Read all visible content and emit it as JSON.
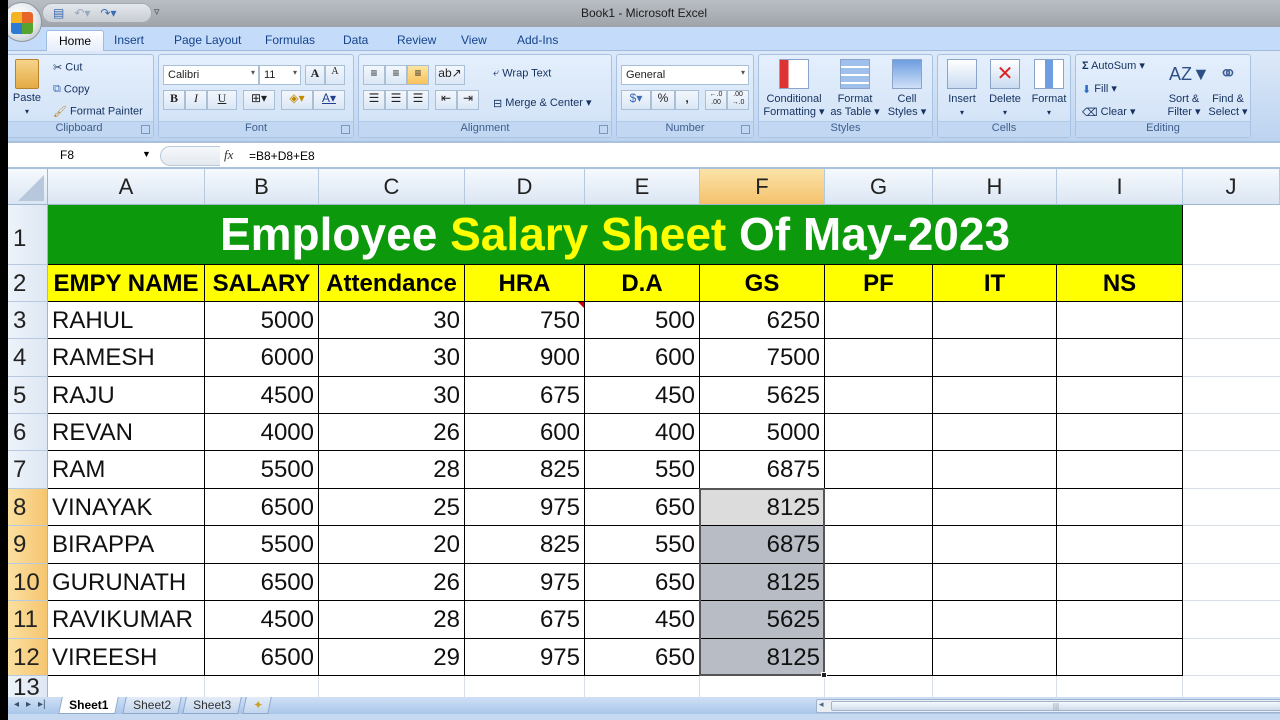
{
  "window": {
    "title": "Book1 - Microsoft Excel"
  },
  "qat": {
    "save_icon": "save-icon",
    "undo_icon": "undo-icon",
    "redo_icon": "redo-icon"
  },
  "tabs": [
    {
      "label": "Home",
      "active": true
    },
    {
      "label": "Insert"
    },
    {
      "label": "Page Layout"
    },
    {
      "label": "Formulas"
    },
    {
      "label": "Data"
    },
    {
      "label": "Review"
    },
    {
      "label": "View"
    },
    {
      "label": "Add-Ins"
    }
  ],
  "ribbon": {
    "clipboard": {
      "label": "Clipboard",
      "paste": "Paste",
      "cut": "Cut",
      "copy": "Copy",
      "format_painter": "Format Painter"
    },
    "font": {
      "label": "Font",
      "font_name": "Calibri",
      "font_size": "11",
      "grow": "A",
      "shrink": "A",
      "bold": "B",
      "italic": "I",
      "underline": "U",
      "font_color": "A"
    },
    "alignment": {
      "label": "Alignment",
      "wrap_text": "Wrap Text",
      "merge_center": "Merge & Center"
    },
    "number": {
      "label": "Number",
      "format": "General",
      "percent": "%",
      "comma": ",",
      "inc_decimal": "←.0 .00",
      "dec_decimal": ".00 →.0"
    },
    "styles": {
      "label": "Styles",
      "conditional_1": "Conditional",
      "conditional_2": "Formatting ▾",
      "format_table_1": "Format",
      "format_table_2": "as Table ▾",
      "cell_styles_1": "Cell",
      "cell_styles_2": "Styles ▾"
    },
    "cells": {
      "label": "Cells",
      "insert": "Insert",
      "delete": "Delete",
      "format": "Format"
    },
    "editing": {
      "label": "Editing",
      "autosum": "AutoSum ▾",
      "fill": "Fill ▾",
      "clear": "Clear ▾",
      "sort_1": "Sort &",
      "sort_2": "Filter ▾",
      "find_1": "Find &",
      "find_2": "Select ▾"
    }
  },
  "formula_bar": {
    "name_box": "F8",
    "fx": "fx",
    "formula": "=B8+D8+E8"
  },
  "columns": [
    "A",
    "B",
    "C",
    "D",
    "E",
    "F",
    "G",
    "H",
    "I",
    "J"
  ],
  "selected_column": "F",
  "sheet": {
    "title_parts": [
      {
        "text": "Employee ",
        "color": "#ffffff"
      },
      {
        "text": "Salary Sheet",
        "color": "#ffff00"
      },
      {
        "text": " Of May-2023",
        "color": "#ffffff"
      }
    ],
    "headers": [
      "EMPY NAME",
      "SALARY",
      "Attendance",
      "HRA",
      "D.A",
      "GS",
      "PF",
      "IT",
      "NS"
    ],
    "rows": [
      {
        "row": "3",
        "name": "RAHUL",
        "salary": "5000",
        "attendance": "30",
        "hra": "750",
        "da": "500",
        "gs": "6250",
        "pf": "",
        "it": "",
        "ns": ""
      },
      {
        "row": "4",
        "name": "RAMESH",
        "salary": "6000",
        "attendance": "30",
        "hra": "900",
        "da": "600",
        "gs": "7500",
        "pf": "",
        "it": "",
        "ns": ""
      },
      {
        "row": "5",
        "name": "RAJU",
        "salary": "4500",
        "attendance": "30",
        "hra": "675",
        "da": "450",
        "gs": "5625",
        "pf": "",
        "it": "",
        "ns": ""
      },
      {
        "row": "6",
        "name": "REVAN",
        "salary": "4000",
        "attendance": "26",
        "hra": "600",
        "da": "400",
        "gs": "5000",
        "pf": "",
        "it": "",
        "ns": ""
      },
      {
        "row": "7",
        "name": "RAM",
        "salary": "5500",
        "attendance": "28",
        "hra": "825",
        "da": "550",
        "gs": "6875",
        "pf": "",
        "it": "",
        "ns": ""
      },
      {
        "row": "8",
        "name": "VINAYAK",
        "salary": "6500",
        "attendance": "25",
        "hra": "975",
        "da": "650",
        "gs": "8125",
        "pf": "",
        "it": "",
        "ns": ""
      },
      {
        "row": "9",
        "name": "BIRAPPA",
        "salary": "5500",
        "attendance": "20",
        "hra": "825",
        "da": "550",
        "gs": "6875",
        "pf": "",
        "it": "",
        "ns": ""
      },
      {
        "row": "10",
        "name": "GURUNATH",
        "salary": "6500",
        "attendance": "26",
        "hra": "975",
        "da": "650",
        "gs": "8125",
        "pf": "",
        "it": "",
        "ns": ""
      },
      {
        "row": "11",
        "name": "RAVIKUMAR",
        "salary": "4500",
        "attendance": "28",
        "hra": "675",
        "da": "450",
        "gs": "5625",
        "pf": "",
        "it": "",
        "ns": ""
      },
      {
        "row": "12",
        "name": "VIREESH",
        "salary": "6500",
        "attendance": "29",
        "hra": "975",
        "da": "650",
        "gs": "8125",
        "pf": "",
        "it": "",
        "ns": ""
      }
    ],
    "selection": {
      "range": "F8:F12",
      "active": "F8"
    },
    "row_labels": [
      "1",
      "2",
      "13"
    ]
  },
  "sheet_tabs": [
    {
      "label": "Sheet1",
      "active": true
    },
    {
      "label": "Sheet2"
    },
    {
      "label": "Sheet3"
    }
  ],
  "colors": {
    "title_bg": "#0c9a0c",
    "header_bg": "#ffff00",
    "selection_bg": "#b8bcc4"
  }
}
